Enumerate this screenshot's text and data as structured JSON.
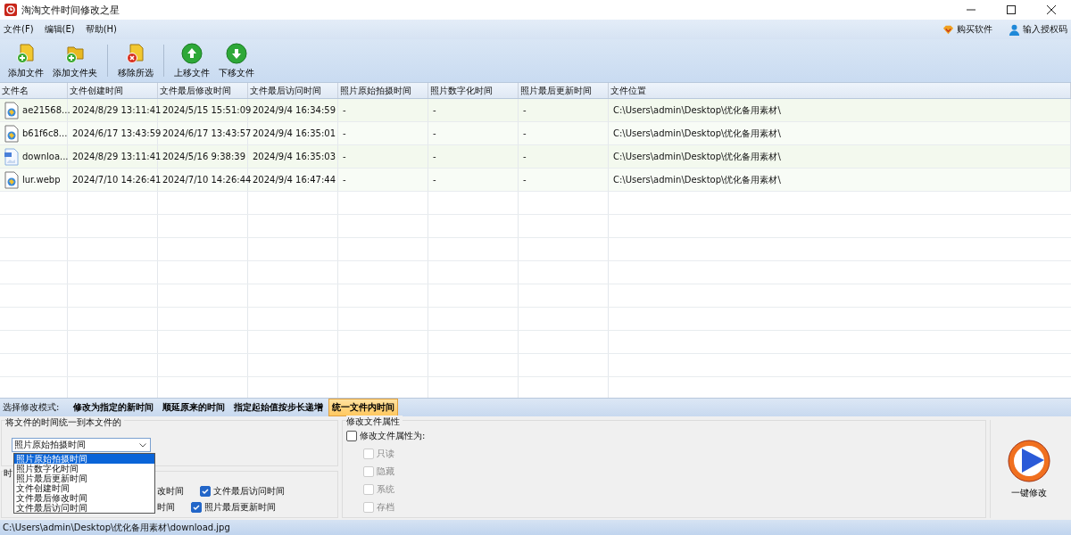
{
  "window": {
    "title": "淘淘文件时间修改之星"
  },
  "menu": [
    "文件(F)",
    "编辑(E)",
    "帮助(H)"
  ],
  "menu_right": [
    {
      "kind": "gem",
      "label": "购买软件"
    },
    {
      "kind": "user",
      "label": "输入授权码"
    }
  ],
  "toolbar": [
    {
      "kind": "add-file",
      "label": "添加文件"
    },
    {
      "kind": "add-folder",
      "label": "添加文件夹"
    },
    {
      "kind": "remove",
      "label": "移除所选"
    },
    {
      "kind": "up",
      "label": "上移文件"
    },
    {
      "kind": "down",
      "label": "下移文件"
    }
  ],
  "table": {
    "columns": [
      "文件名",
      "文件创建时间",
      "文件最后修改时间",
      "文件最后访问时间",
      "照片原始拍摄时间",
      "照片数字化时间",
      "照片最后更新时间",
      "文件位置"
    ],
    "rows": [
      {
        "kind": "image",
        "cells": [
          "ae21568...",
          "2024/8/29 13:11:41",
          "2024/5/15 15:51:09",
          "2024/9/4 16:34:59",
          "-",
          "-",
          "-",
          "C:\\Users\\admin\\Desktop\\优化备用素材\\"
        ]
      },
      {
        "kind": "image",
        "cells": [
          "b61f6c8...",
          "2024/6/17 13:43:59",
          "2024/6/17 13:43:57",
          "2024/9/4 16:35:01",
          "-",
          "-",
          "-",
          "C:\\Users\\admin\\Desktop\\优化备用素材\\"
        ]
      },
      {
        "kind": "jpg",
        "cells": [
          "downloa...",
          "2024/8/29 13:11:41",
          "2024/5/16 9:38:39",
          "2024/9/4 16:35:03",
          "-",
          "-",
          "-",
          "C:\\Users\\admin\\Desktop\\优化备用素材\\"
        ]
      },
      {
        "kind": "image",
        "cells": [
          "lur.webp",
          "2024/7/10 14:26:41",
          "2024/7/10 14:26:44",
          "2024/9/4 16:47:44",
          "-",
          "-",
          "-",
          "C:\\Users\\admin\\Desktop\\优化备用素材\\"
        ]
      }
    ]
  },
  "mode": {
    "label": "选择修改模式:",
    "tabs": [
      {
        "label": "修改为指定的新时间",
        "selected": false
      },
      {
        "label": "顺延原来的时间",
        "selected": false
      },
      {
        "label": "指定起始值按步长递增",
        "selected": false
      },
      {
        "label": "统一文件内时间",
        "selected": true
      }
    ]
  },
  "unify": {
    "title": "将文件的时间统一到本文件的",
    "select": {
      "value": "照片原始拍摄时间",
      "options": [
        {
          "label": "照片原始拍摄时间",
          "selected": true
        },
        {
          "label": "照片数字化时间",
          "selected": false
        },
        {
          "label": "照片最后更新时间",
          "selected": false
        },
        {
          "label": "文件创建时间",
          "selected": false
        },
        {
          "label": "文件最后修改时间",
          "selected": false
        },
        {
          "label": "文件最后访问时间",
          "selected": false
        }
      ]
    }
  },
  "target": {
    "title": "时",
    "fragments": [
      "改时间",
      "时间"
    ],
    "checks": [
      {
        "label": "文件最后访问时间",
        "checked": true
      },
      {
        "label": "照片最后更新时间",
        "checked": true
      }
    ]
  },
  "attributes": {
    "title": "修改文件属性",
    "master": {
      "label": "修改文件属性为:",
      "checked": false
    },
    "items": [
      {
        "label": "只读",
        "checked": false,
        "disabled": true
      },
      {
        "label": "隐藏",
        "checked": false,
        "disabled": true
      },
      {
        "label": "系统",
        "checked": false,
        "disabled": true
      },
      {
        "label": "存档",
        "checked": false,
        "disabled": true
      }
    ]
  },
  "run_button": {
    "label": "一键修改"
  },
  "status_bar": "C:\\Users\\admin\\Desktop\\优化备用素材\\download.jpg"
}
